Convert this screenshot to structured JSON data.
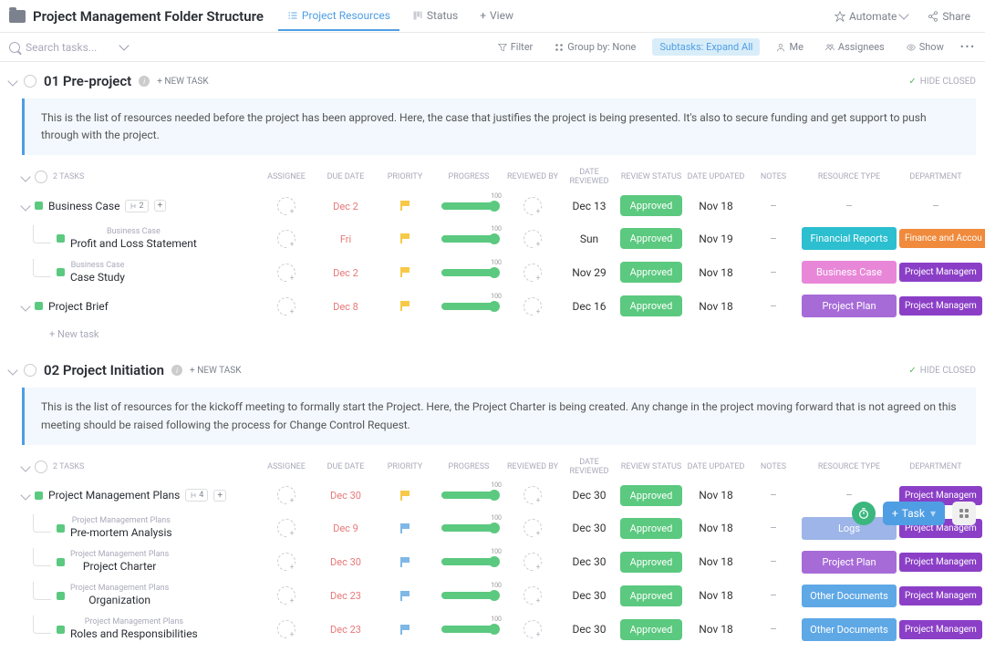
{
  "header": {
    "title": "Project Management Folder Structure",
    "tabs": [
      {
        "label": "Project Resources",
        "active": true
      },
      {
        "label": "Status"
      },
      {
        "label": "View",
        "icon": "plus"
      }
    ],
    "automate": "Automate",
    "share": "Share"
  },
  "toolbar": {
    "search_placeholder": "Search tasks...",
    "filter": "Filter",
    "group_by": "Group by: None",
    "subtasks": "Subtasks: Expand All",
    "me": "Me",
    "assignees": "Assignees",
    "show": "Show"
  },
  "sections": [
    {
      "title": "01 Pre-project",
      "new_task": "+ NEW TASK",
      "hide_closed": "HIDE CLOSED",
      "desc": "This is the list of resources needed before the project has been approved. Here, the case that justifies the project is being presented. It's also to secure funding and get support to push through with the project.",
      "task_count": "2 TASKS",
      "tasks": [
        {
          "name": "Business Case",
          "sub_count": "2",
          "due": "Dec 2",
          "flag": "yellow",
          "progress": 100,
          "date_reviewed": "Dec 13",
          "review_status": "Approved",
          "date_updated": "Nov 18",
          "notes": "–",
          "resource_type": "–",
          "dept": "–",
          "dept_color": ""
        },
        {
          "parent": "Business Case",
          "name": "Profit and Loss Statement",
          "due": "Fri",
          "flag": "yellow",
          "progress": 100,
          "date_reviewed": "Sun",
          "review_status": "Approved",
          "date_updated": "Nov 19",
          "notes": "–",
          "resource_type": "Financial Reports",
          "rtype_color": "teal",
          "dept": "Finance and Accou",
          "dept_color": "orange"
        },
        {
          "parent": "Business Case",
          "name": "Case Study",
          "due": "Dec 2",
          "flag": "yellow",
          "progress": 100,
          "date_reviewed": "Nov 29",
          "review_status": "Approved",
          "date_updated": "Nov 18",
          "notes": "–",
          "resource_type": "Business Case",
          "rtype_color": "pink",
          "dept": "Project Managem",
          "dept_color": "purple"
        },
        {
          "name": "Project Brief",
          "due": "Dec 8",
          "flag": "yellow",
          "progress": 100,
          "date_reviewed": "Dec 16",
          "review_status": "Approved",
          "date_updated": "Nov 18",
          "notes": "–",
          "resource_type": "Project Plan",
          "rtype_color": "purple",
          "dept": "Project Managem",
          "dept_color": "purple"
        }
      ],
      "new_task_row": "+ New task"
    },
    {
      "title": "02 Project Initiation",
      "new_task": "+ NEW TASK",
      "hide_closed": "HIDE CLOSED",
      "desc": "This is the list of resources for the kickoff meeting to formally start the Project. Here, the Project Charter is being created. Any change in the project moving forward that is not agreed on this meeting should be raised following the process for Change Control Request.",
      "task_count": "2 TASKS",
      "tasks": [
        {
          "name": "Project Management Plans",
          "sub_count": "4",
          "due": "Dec 30",
          "flag": "yellow",
          "progress": 100,
          "date_reviewed": "Dec 30",
          "review_status": "Approved",
          "date_updated": "Nov 18",
          "notes": "–",
          "resource_type": "–",
          "dept": "Project Managem",
          "dept_color": "purple"
        },
        {
          "parent": "Project Management Plans",
          "name": "Pre-mortem Analysis",
          "due": "Dec 9",
          "flag": "blue",
          "progress": 100,
          "date_reviewed": "Dec 30",
          "review_status": "Approved",
          "date_updated": "Nov 18",
          "notes": "–",
          "resource_type": "Logs",
          "rtype_color": "lav",
          "dept": "Project Managem",
          "dept_color": "purple"
        },
        {
          "parent": "Project Management Plans",
          "name": "Project Charter",
          "due": "Dec 30",
          "flag": "blue",
          "progress": 100,
          "date_reviewed": "Dec 30",
          "review_status": "Approved",
          "date_updated": "Nov 18",
          "notes": "–",
          "resource_type": "Project Plan",
          "rtype_color": "purple",
          "dept": "Project Managem",
          "dept_color": "purple"
        },
        {
          "parent": "Project Management Plans",
          "name": "Organization",
          "due": "Dec 23",
          "flag": "blue",
          "progress": 100,
          "date_reviewed": "Dec 30",
          "review_status": "Approved",
          "date_updated": "Nov 18",
          "notes": "–",
          "resource_type": "Other Documents",
          "rtype_color": "blue",
          "dept": "Project Managem",
          "dept_color": "purple"
        },
        {
          "parent": "Project Management Plans",
          "name": "Roles and Responsibilities",
          "due": "Dec 23",
          "flag": "blue",
          "progress": 100,
          "date_reviewed": "Dec 30",
          "review_status": "Approved",
          "date_updated": "Nov 18",
          "notes": "–",
          "resource_type": "Other Documents",
          "rtype_color": "blue",
          "dept": "Project Managem",
          "dept_color": "purple"
        }
      ]
    }
  ],
  "columns": [
    "ASSIGNEE",
    "DUE DATE",
    "PRIORITY",
    "PROGRESS",
    "REVIEWED BY",
    "DATE REVIEWED",
    "REVIEW STATUS",
    "DATE UPDATED",
    "NOTES",
    "RESOURCE TYPE",
    "DEPARTMENT"
  ],
  "fab": {
    "task": "Task"
  }
}
